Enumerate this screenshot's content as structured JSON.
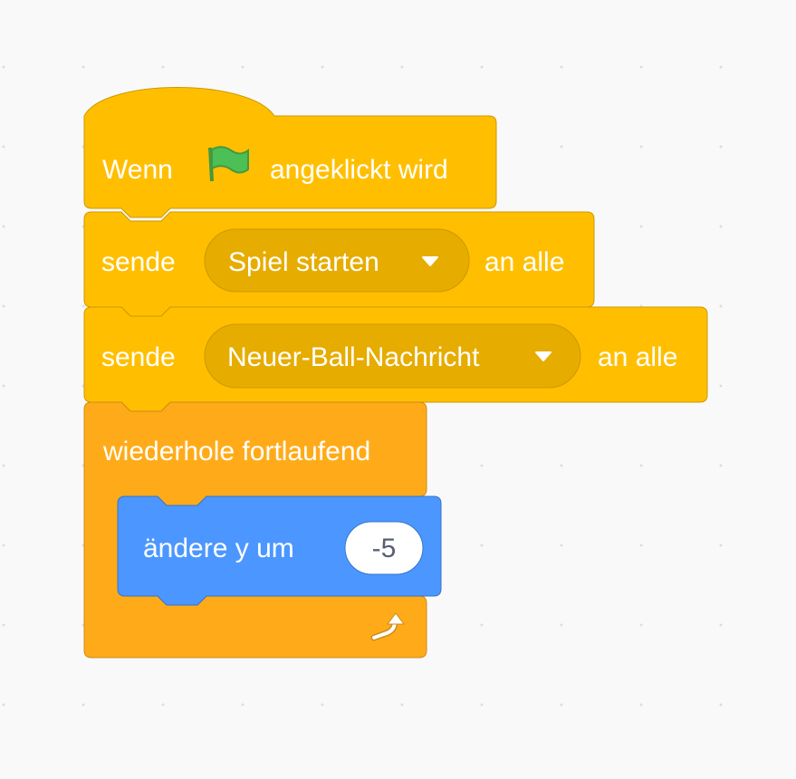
{
  "workspace": {
    "background": "#f9f9f9",
    "grid_dot_color": "#dddddd"
  },
  "script": {
    "hat_block": {
      "label_before": "Wenn",
      "icon": "green-flag-icon",
      "label_after": "angeklickt wird",
      "color": "#ffbf00"
    },
    "broadcast_blocks": [
      {
        "label": "sende",
        "message": "Spiel starten",
        "suffix": "an alle",
        "color": "#ffbf00"
      },
      {
        "label": "sende",
        "message": "Neuer-Ball-Nachricht",
        "suffix": "an alle",
        "color": "#ffbf00"
      }
    ],
    "forever_block": {
      "label": "wiederhole fortlaufend",
      "color": "#ffab19",
      "loop_icon": "loop-arrow-icon"
    },
    "motion_block": {
      "label": "ändere y um",
      "value": "-5",
      "color": "#4c97ff"
    }
  }
}
